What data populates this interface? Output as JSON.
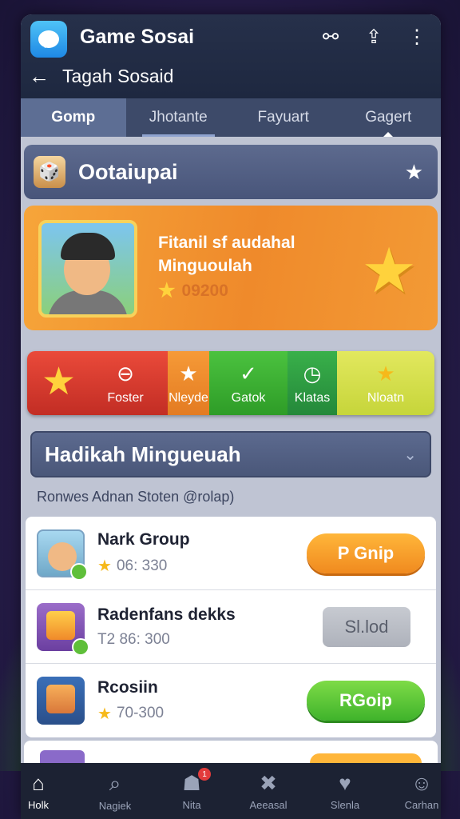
{
  "header": {
    "app_title": "Game Sosai",
    "subtitle": "Tagah Sosaid",
    "icons": [
      "network-icon",
      "share-icon",
      "more-icon"
    ]
  },
  "tabs": [
    {
      "label": "Gomp",
      "active": true
    },
    {
      "label": "Jhotante",
      "active": false
    },
    {
      "label": "Fayuart",
      "active": false
    },
    {
      "label": "Gagert",
      "active": false
    }
  ],
  "section": {
    "title": "Ootaiupai",
    "pin_icon": "★"
  },
  "hero": {
    "title_line1": "Fitanil sf audahal",
    "title_line2": "Minguoulah",
    "score": "09200"
  },
  "actions": [
    {
      "label": "Foster",
      "icon": "⊖"
    },
    {
      "label": "Nleyde",
      "icon": "★"
    },
    {
      "label": "Gatok",
      "icon": "✓"
    },
    {
      "label": "Klatas",
      "icon": "◷"
    },
    {
      "label": "Nloatn",
      "icon": "★"
    }
  ],
  "dropdown": {
    "label": "Hadikah Mingueuah"
  },
  "list_caption": "Ronwes Adnan Stoten @rolap)",
  "rows": [
    {
      "name": "Nark Group",
      "meta": "06: 330",
      "button": "P Gnip",
      "style": "orange"
    },
    {
      "name": "Radenfans dekks",
      "meta": "T2 86: 300",
      "button": "Sl.lod",
      "style": "grey"
    },
    {
      "name": "Rcosiin",
      "meta": "70-300",
      "button": "RGoip",
      "style": "green"
    }
  ],
  "nav": [
    {
      "label": "Holk",
      "icon": "⌂",
      "active": true
    },
    {
      "label": "Nagiek",
      "icon": "⌕",
      "active": false
    },
    {
      "label": "Nita",
      "icon": "☗",
      "active": false,
      "badge": "1"
    },
    {
      "label": "Aeeasal",
      "icon": "✖",
      "active": false
    },
    {
      "label": "Slenla",
      "icon": "♥",
      "active": false
    },
    {
      "label": "Carhan",
      "icon": "☺",
      "active": false
    }
  ],
  "colors": {
    "topbar": "#26304a",
    "hero": "#ef8a2b",
    "accent_orange": "#f08a1f",
    "accent_green": "#3fb32b",
    "star": "#ffd23c"
  }
}
